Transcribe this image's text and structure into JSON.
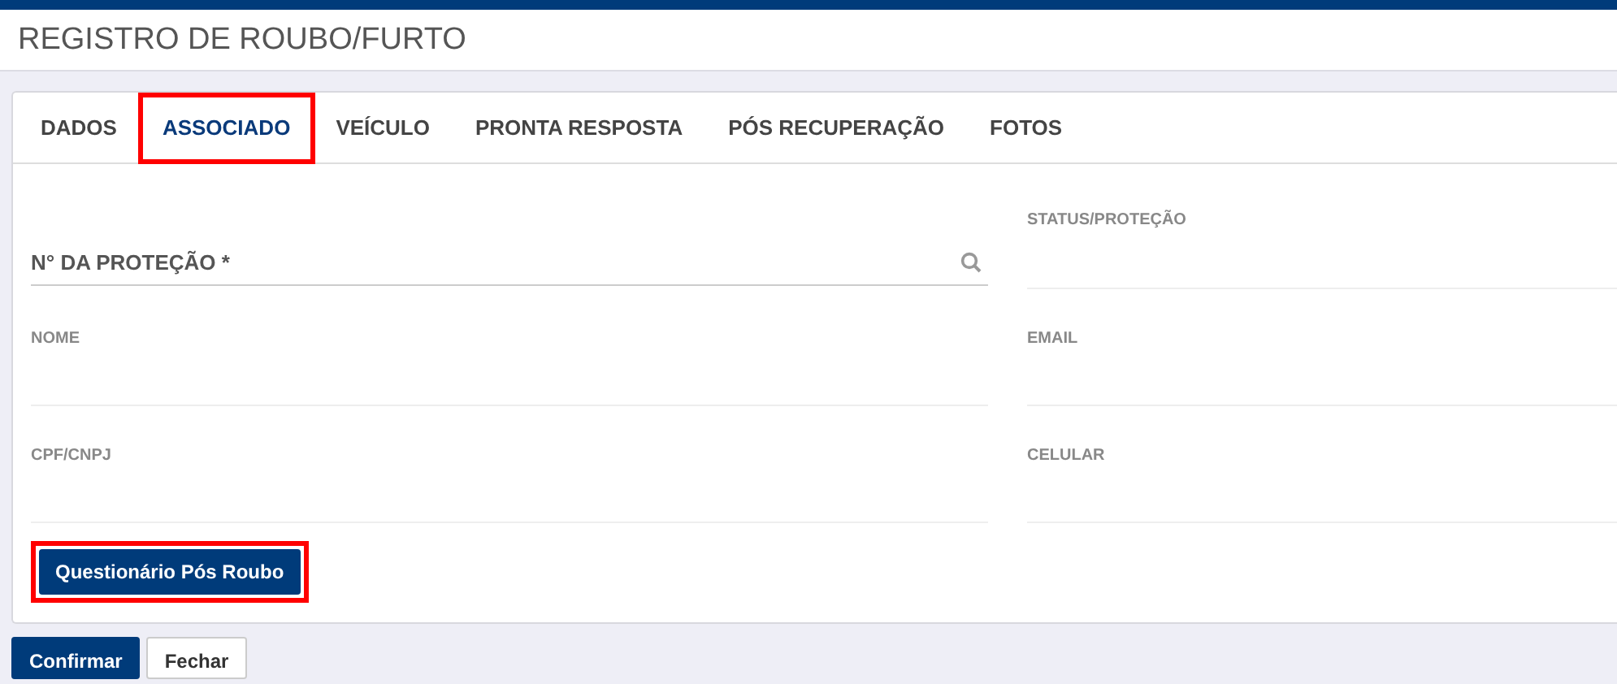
{
  "title": "REGISTRO DE ROUBO/FURTO",
  "tabs": [
    {
      "label": "DADOS",
      "selected": false,
      "highlighted": false
    },
    {
      "label": "ASSOCIADO",
      "selected": true,
      "highlighted": true
    },
    {
      "label": "VEÍCULO",
      "selected": false,
      "highlighted": false
    },
    {
      "label": "PRONTA RESPOSTA",
      "selected": false,
      "highlighted": false
    },
    {
      "label": "PÓS RECUPERAÇÃO",
      "selected": false,
      "highlighted": false
    },
    {
      "label": "FOTOS",
      "selected": false,
      "highlighted": false
    }
  ],
  "left_fields": [
    {
      "label": "N° DA PROTEÇÃO *",
      "kind": "search"
    },
    {
      "label": "NOME",
      "kind": "text"
    },
    {
      "label": "CPF/CNPJ",
      "kind": "text"
    }
  ],
  "right_fields": [
    {
      "label": "STATUS/PROTEÇÃO",
      "kind": "text"
    },
    {
      "label": "EMAIL",
      "kind": "text"
    },
    {
      "label": "CELULAR",
      "kind": "text"
    }
  ],
  "questionnaire_button": {
    "label": "Questionário Pós Roubo",
    "highlighted": true
  },
  "footer_buttons": [
    {
      "label": "Confirmar",
      "kind": "primary"
    },
    {
      "label": "Fechar",
      "kind": "secondary"
    }
  ]
}
